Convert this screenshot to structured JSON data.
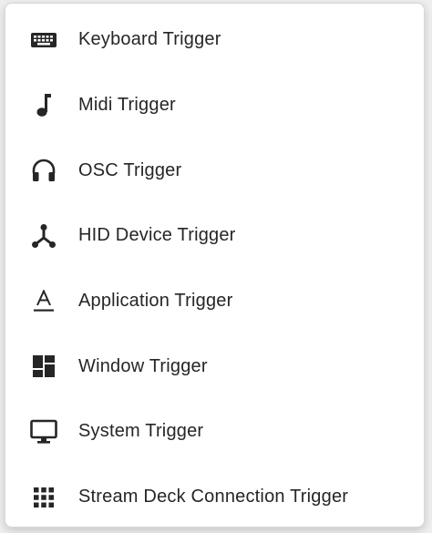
{
  "menu": {
    "items": [
      {
        "label": "Keyboard Trigger",
        "icon": "keyboard-icon"
      },
      {
        "label": "Midi Trigger",
        "icon": "music-note-icon"
      },
      {
        "label": "OSC Trigger",
        "icon": "headphones-icon"
      },
      {
        "label": "HID Device Trigger",
        "icon": "usb-hub-icon"
      },
      {
        "label": "Application Trigger",
        "icon": "text-a-icon"
      },
      {
        "label": "Window Trigger",
        "icon": "dashboard-icon"
      },
      {
        "label": "System Trigger",
        "icon": "monitor-icon"
      },
      {
        "label": "Stream Deck Connection Trigger",
        "icon": "grid-icon"
      }
    ]
  },
  "colors": {
    "icon": "#262626",
    "text": "#262626",
    "menu_background": "#ffffff"
  }
}
